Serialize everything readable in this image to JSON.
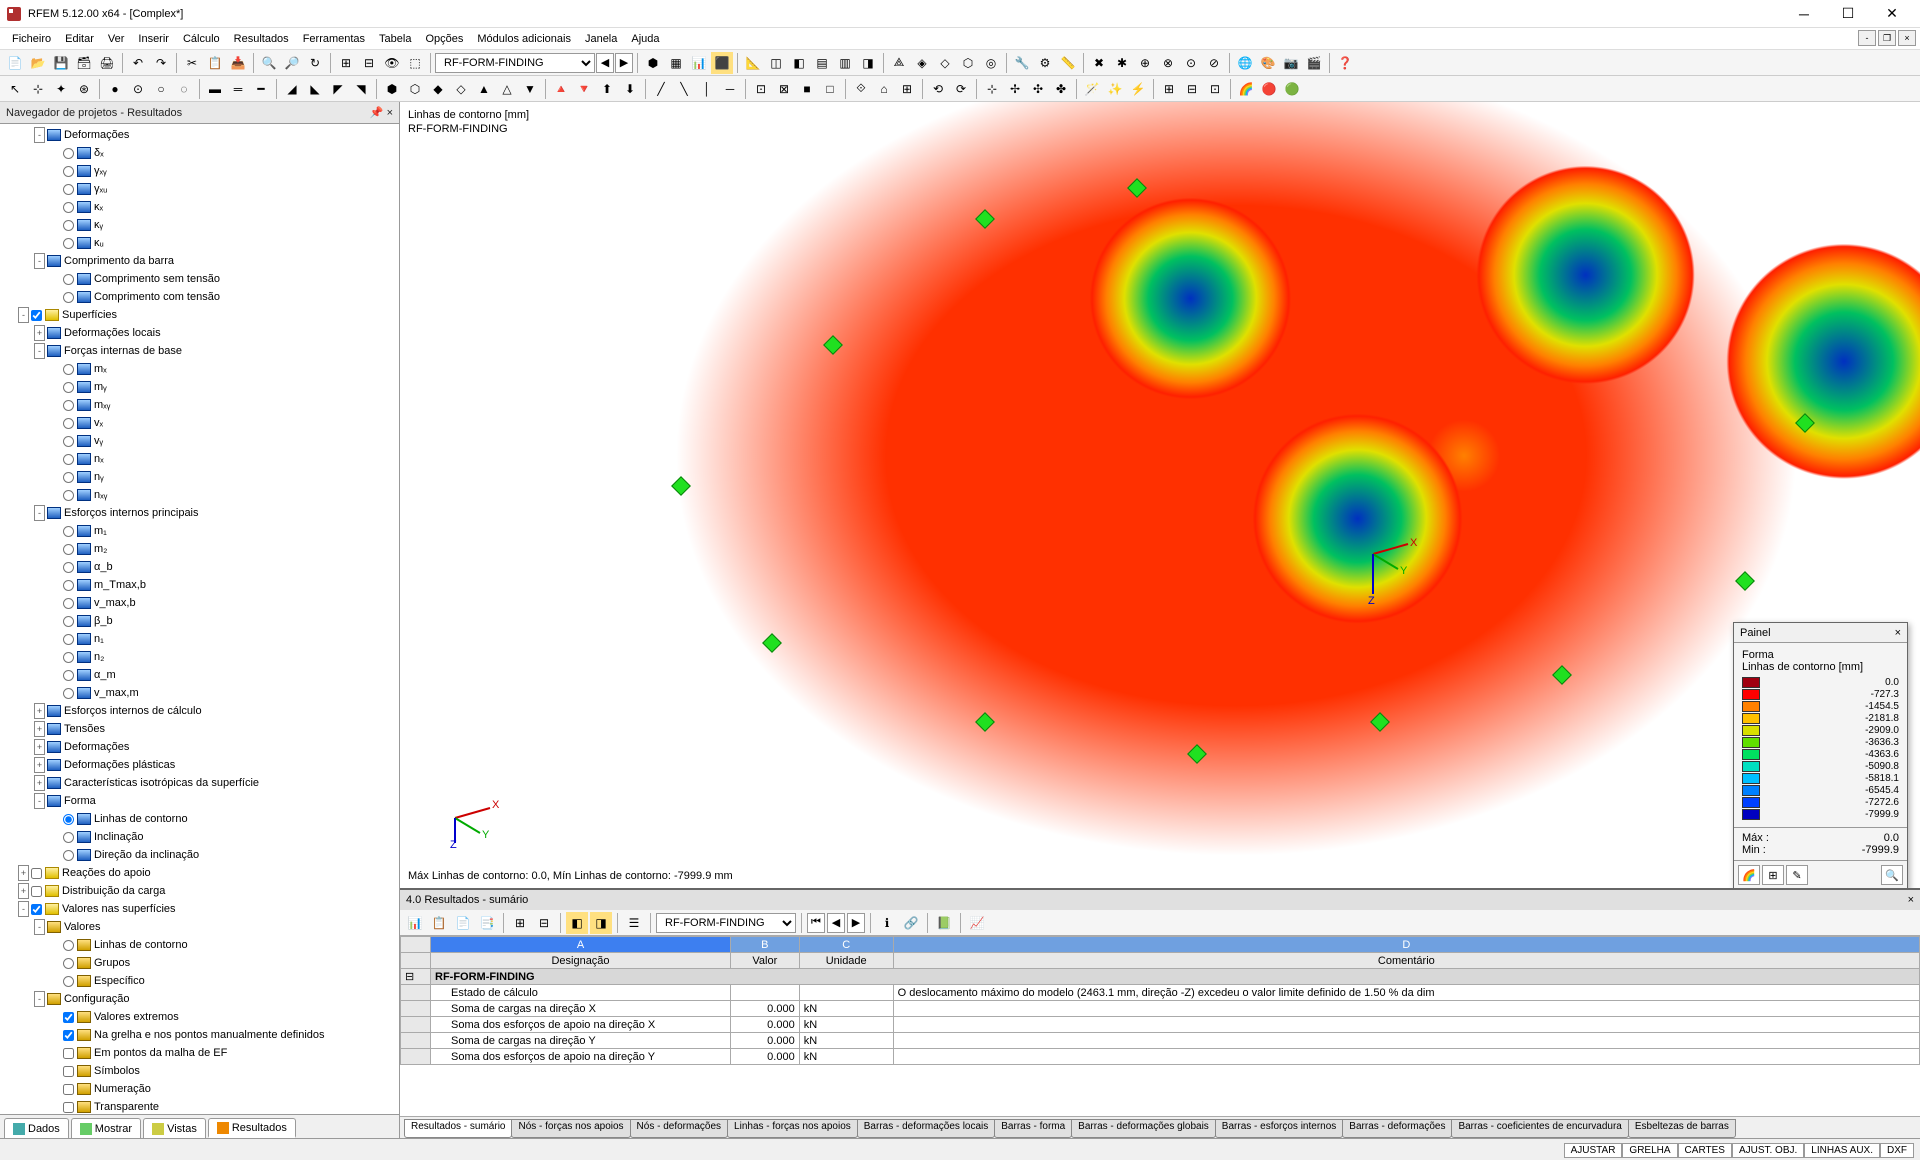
{
  "title": "RFEM 5.12.00 x64 - [Complex*]",
  "menus": [
    "Ficheiro",
    "Editar",
    "Ver",
    "Inserir",
    "Cálculo",
    "Resultados",
    "Ferramentas",
    "Tabela",
    "Opções",
    "Módulos adicionais",
    "Janela",
    "Ajuda"
  ],
  "toolbar_combo": "RF-FORM-FINDING",
  "navigator": {
    "title": "Navegador de projetos - Resultados",
    "tabs": [
      {
        "icon": "#4aa",
        "label": "Dados"
      },
      {
        "icon": "#6c6",
        "label": "Mostrar"
      },
      {
        "icon": "#cc4",
        "label": "Vistas"
      },
      {
        "icon": "#e80",
        "label": "Resultados"
      }
    ],
    "active_tab": 3,
    "tree": [
      {
        "d": 2,
        "exp": "-",
        "chk": null,
        "ico": "blue",
        "label": "Deformações"
      },
      {
        "d": 3,
        "exp": "",
        "chk": "r",
        "ico": "blue",
        "label": "δₓ"
      },
      {
        "d": 3,
        "exp": "",
        "chk": "r",
        "ico": "blue",
        "label": "γₓᵧ"
      },
      {
        "d": 3,
        "exp": "",
        "chk": "r",
        "ico": "blue",
        "label": "γₓᵤ"
      },
      {
        "d": 3,
        "exp": "",
        "chk": "r",
        "ico": "blue",
        "label": "κₓ"
      },
      {
        "d": 3,
        "exp": "",
        "chk": "r",
        "ico": "blue",
        "label": "κᵧ"
      },
      {
        "d": 3,
        "exp": "",
        "chk": "r",
        "ico": "blue",
        "label": "κᵤ"
      },
      {
        "d": 2,
        "exp": "-",
        "chk": null,
        "ico": "blue",
        "label": "Comprimento da barra"
      },
      {
        "d": 3,
        "exp": "",
        "chk": "r",
        "ico": "blue",
        "label": "Comprimento sem tensão"
      },
      {
        "d": 3,
        "exp": "",
        "chk": "r",
        "ico": "blue",
        "label": "Comprimento com tensão"
      },
      {
        "d": 1,
        "exp": "-",
        "chk": "c1",
        "ico": "yellow",
        "label": "Superfícies"
      },
      {
        "d": 2,
        "exp": "+",
        "chk": null,
        "ico": "blue",
        "label": "Deformações locais"
      },
      {
        "d": 2,
        "exp": "-",
        "chk": null,
        "ico": "blue",
        "label": "Forças internas de base"
      },
      {
        "d": 3,
        "exp": "",
        "chk": "r",
        "ico": "blue",
        "label": "mₓ"
      },
      {
        "d": 3,
        "exp": "",
        "chk": "r",
        "ico": "blue",
        "label": "mᵧ"
      },
      {
        "d": 3,
        "exp": "",
        "chk": "r",
        "ico": "blue",
        "label": "mₓᵧ"
      },
      {
        "d": 3,
        "exp": "",
        "chk": "r",
        "ico": "blue",
        "label": "vₓ"
      },
      {
        "d": 3,
        "exp": "",
        "chk": "r",
        "ico": "blue",
        "label": "vᵧ"
      },
      {
        "d": 3,
        "exp": "",
        "chk": "r",
        "ico": "blue",
        "label": "nₓ"
      },
      {
        "d": 3,
        "exp": "",
        "chk": "r",
        "ico": "blue",
        "label": "nᵧ"
      },
      {
        "d": 3,
        "exp": "",
        "chk": "r",
        "ico": "blue",
        "label": "nₓᵧ"
      },
      {
        "d": 2,
        "exp": "-",
        "chk": null,
        "ico": "blue",
        "label": "Esforços internos principais"
      },
      {
        "d": 3,
        "exp": "",
        "chk": "r",
        "ico": "blue",
        "label": "m₁"
      },
      {
        "d": 3,
        "exp": "",
        "chk": "r",
        "ico": "blue",
        "label": "m₂"
      },
      {
        "d": 3,
        "exp": "",
        "chk": "r",
        "ico": "blue",
        "label": "α_b"
      },
      {
        "d": 3,
        "exp": "",
        "chk": "r",
        "ico": "blue",
        "label": "m_Tmax,b"
      },
      {
        "d": 3,
        "exp": "",
        "chk": "r",
        "ico": "blue",
        "label": "v_max,b"
      },
      {
        "d": 3,
        "exp": "",
        "chk": "r",
        "ico": "blue",
        "label": "β_b"
      },
      {
        "d": 3,
        "exp": "",
        "chk": "r",
        "ico": "blue",
        "label": "n₁"
      },
      {
        "d": 3,
        "exp": "",
        "chk": "r",
        "ico": "blue",
        "label": "n₂"
      },
      {
        "d": 3,
        "exp": "",
        "chk": "r",
        "ico": "blue",
        "label": "α_m"
      },
      {
        "d": 3,
        "exp": "",
        "chk": "r",
        "ico": "blue",
        "label": "v_max,m"
      },
      {
        "d": 2,
        "exp": "+",
        "chk": null,
        "ico": "blue",
        "label": "Esforços internos de cálculo"
      },
      {
        "d": 2,
        "exp": "+",
        "chk": null,
        "ico": "blue",
        "label": "Tensões"
      },
      {
        "d": 2,
        "exp": "+",
        "chk": null,
        "ico": "blue",
        "label": "Deformações"
      },
      {
        "d": 2,
        "exp": "+",
        "chk": null,
        "ico": "blue",
        "label": "Deformações plásticas"
      },
      {
        "d": 2,
        "exp": "+",
        "chk": null,
        "ico": "blue",
        "label": "Características isotrópicas da superfície"
      },
      {
        "d": 2,
        "exp": "-",
        "chk": null,
        "ico": "blue",
        "label": "Forma"
      },
      {
        "d": 3,
        "exp": "",
        "chk": "r1",
        "ico": "blue",
        "label": "Linhas de contorno"
      },
      {
        "d": 3,
        "exp": "",
        "chk": "r",
        "ico": "blue",
        "label": "Inclinação"
      },
      {
        "d": 3,
        "exp": "",
        "chk": "r",
        "ico": "blue",
        "label": "Direção da inclinação"
      },
      {
        "d": 1,
        "exp": "+",
        "chk": "c",
        "ico": "yellow",
        "label": "Reações do apoio"
      },
      {
        "d": 1,
        "exp": "+",
        "chk": "c",
        "ico": "yellow",
        "label": "Distribuição da carga"
      },
      {
        "d": 1,
        "exp": "-",
        "chk": "c1",
        "ico": "yellow",
        "label": "Valores nas superfícies"
      },
      {
        "d": 2,
        "exp": "-",
        "chk": null,
        "ico": "folder",
        "label": "Valores"
      },
      {
        "d": 3,
        "exp": "",
        "chk": "r",
        "ico": "folder",
        "label": "Linhas de contorno"
      },
      {
        "d": 3,
        "exp": "",
        "chk": "r",
        "ico": "folder",
        "label": "Grupos"
      },
      {
        "d": 3,
        "exp": "",
        "chk": "r",
        "ico": "folder",
        "label": "Específico"
      },
      {
        "d": 2,
        "exp": "-",
        "chk": null,
        "ico": "folder",
        "label": "Configuração"
      },
      {
        "d": 3,
        "exp": "",
        "chk": "c1",
        "ico": "folder",
        "label": "Valores extremos"
      },
      {
        "d": 3,
        "exp": "",
        "chk": "c1",
        "ico": "folder",
        "label": "Na grelha e nos pontos manualmente definidos"
      },
      {
        "d": 3,
        "exp": "",
        "chk": "c",
        "ico": "folder",
        "label": "Em pontos da malha de EF"
      },
      {
        "d": 3,
        "exp": "",
        "chk": "c",
        "ico": "folder",
        "label": "Símbolos"
      },
      {
        "d": 3,
        "exp": "",
        "chk": "c",
        "ico": "folder",
        "label": "Numeração"
      },
      {
        "d": 3,
        "exp": "",
        "chk": "c",
        "ico": "folder",
        "label": "Transparente"
      }
    ]
  },
  "viewport": {
    "line1": "Linhas de contorno [mm]",
    "line2": "RF-FORM-FINDING",
    "footer": "Máx Linhas de contorno: 0.0, Mín Linhas de contorno: -7999.9 mm"
  },
  "legend": {
    "title": "Painel",
    "subtitle1": "Forma",
    "subtitle2": "Linhas de contorno [mm]",
    "items": [
      {
        "color": "#a00010",
        "val": "0.0"
      },
      {
        "color": "#ff0000",
        "val": "-727.3"
      },
      {
        "color": "#ff8000",
        "val": "-1454.5"
      },
      {
        "color": "#ffc000",
        "val": "-2181.8"
      },
      {
        "color": "#d8e000",
        "val": "-2909.0"
      },
      {
        "color": "#60e000",
        "val": "-3636.3"
      },
      {
        "color": "#00e060",
        "val": "-4363.6"
      },
      {
        "color": "#00e0c0",
        "val": "-5090.8"
      },
      {
        "color": "#00c0ff",
        "val": "-5818.1"
      },
      {
        "color": "#0080ff",
        "val": "-6545.4"
      },
      {
        "color": "#0040ff",
        "val": "-7272.6"
      },
      {
        "color": "#0000c0",
        "val": "-7999.9"
      }
    ],
    "max_label": "Máx :",
    "max_val": "0.0",
    "min_label": "Min :",
    "min_val": "-7999.9"
  },
  "results": {
    "header": "4.0 Resultados - sumário",
    "combo": "RF-FORM-FINDING",
    "col_letters": [
      "A",
      "B",
      "C",
      "D"
    ],
    "columns": [
      "Designação",
      "Valor",
      "Unidade",
      "Comentário"
    ],
    "group": "RF-FORM-FINDING",
    "rows": [
      {
        "d": "Estado de cálculo",
        "v": "",
        "u": "",
        "c": "O deslocamento máximo do modelo (2463.1 mm, direção -Z) excedeu o valor limite definido de 1.50 % da dim"
      },
      {
        "d": "Soma de cargas na direção X",
        "v": "0.000",
        "u": "kN",
        "c": ""
      },
      {
        "d": "Soma dos esforços de apoio na direção X",
        "v": "0.000",
        "u": "kN",
        "c": ""
      },
      {
        "d": "Soma de cargas na direção Y",
        "v": "0.000",
        "u": "kN",
        "c": ""
      },
      {
        "d": "Soma dos esforços de apoio na direção Y",
        "v": "0.000",
        "u": "kN",
        "c": ""
      }
    ],
    "tabs": [
      "Resultados - sumário",
      "Nós - forças nos apoios",
      "Nós - deformações",
      "Linhas - forças nos apoios",
      "Barras - deformações locais",
      "Barras - forma",
      "Barras - deformações globais",
      "Barras - esforços internos",
      "Barras - deformações",
      "Barras - coeficientes de encurvadura",
      "Esbeltezas de barras"
    ],
    "active_tab": 0
  },
  "statusbar": {
    "buttons": [
      "AJUSTAR",
      "GRELHA",
      "CARTES",
      "AJUST. OBJ.",
      "LINHAS AUX.",
      "DXF"
    ]
  }
}
